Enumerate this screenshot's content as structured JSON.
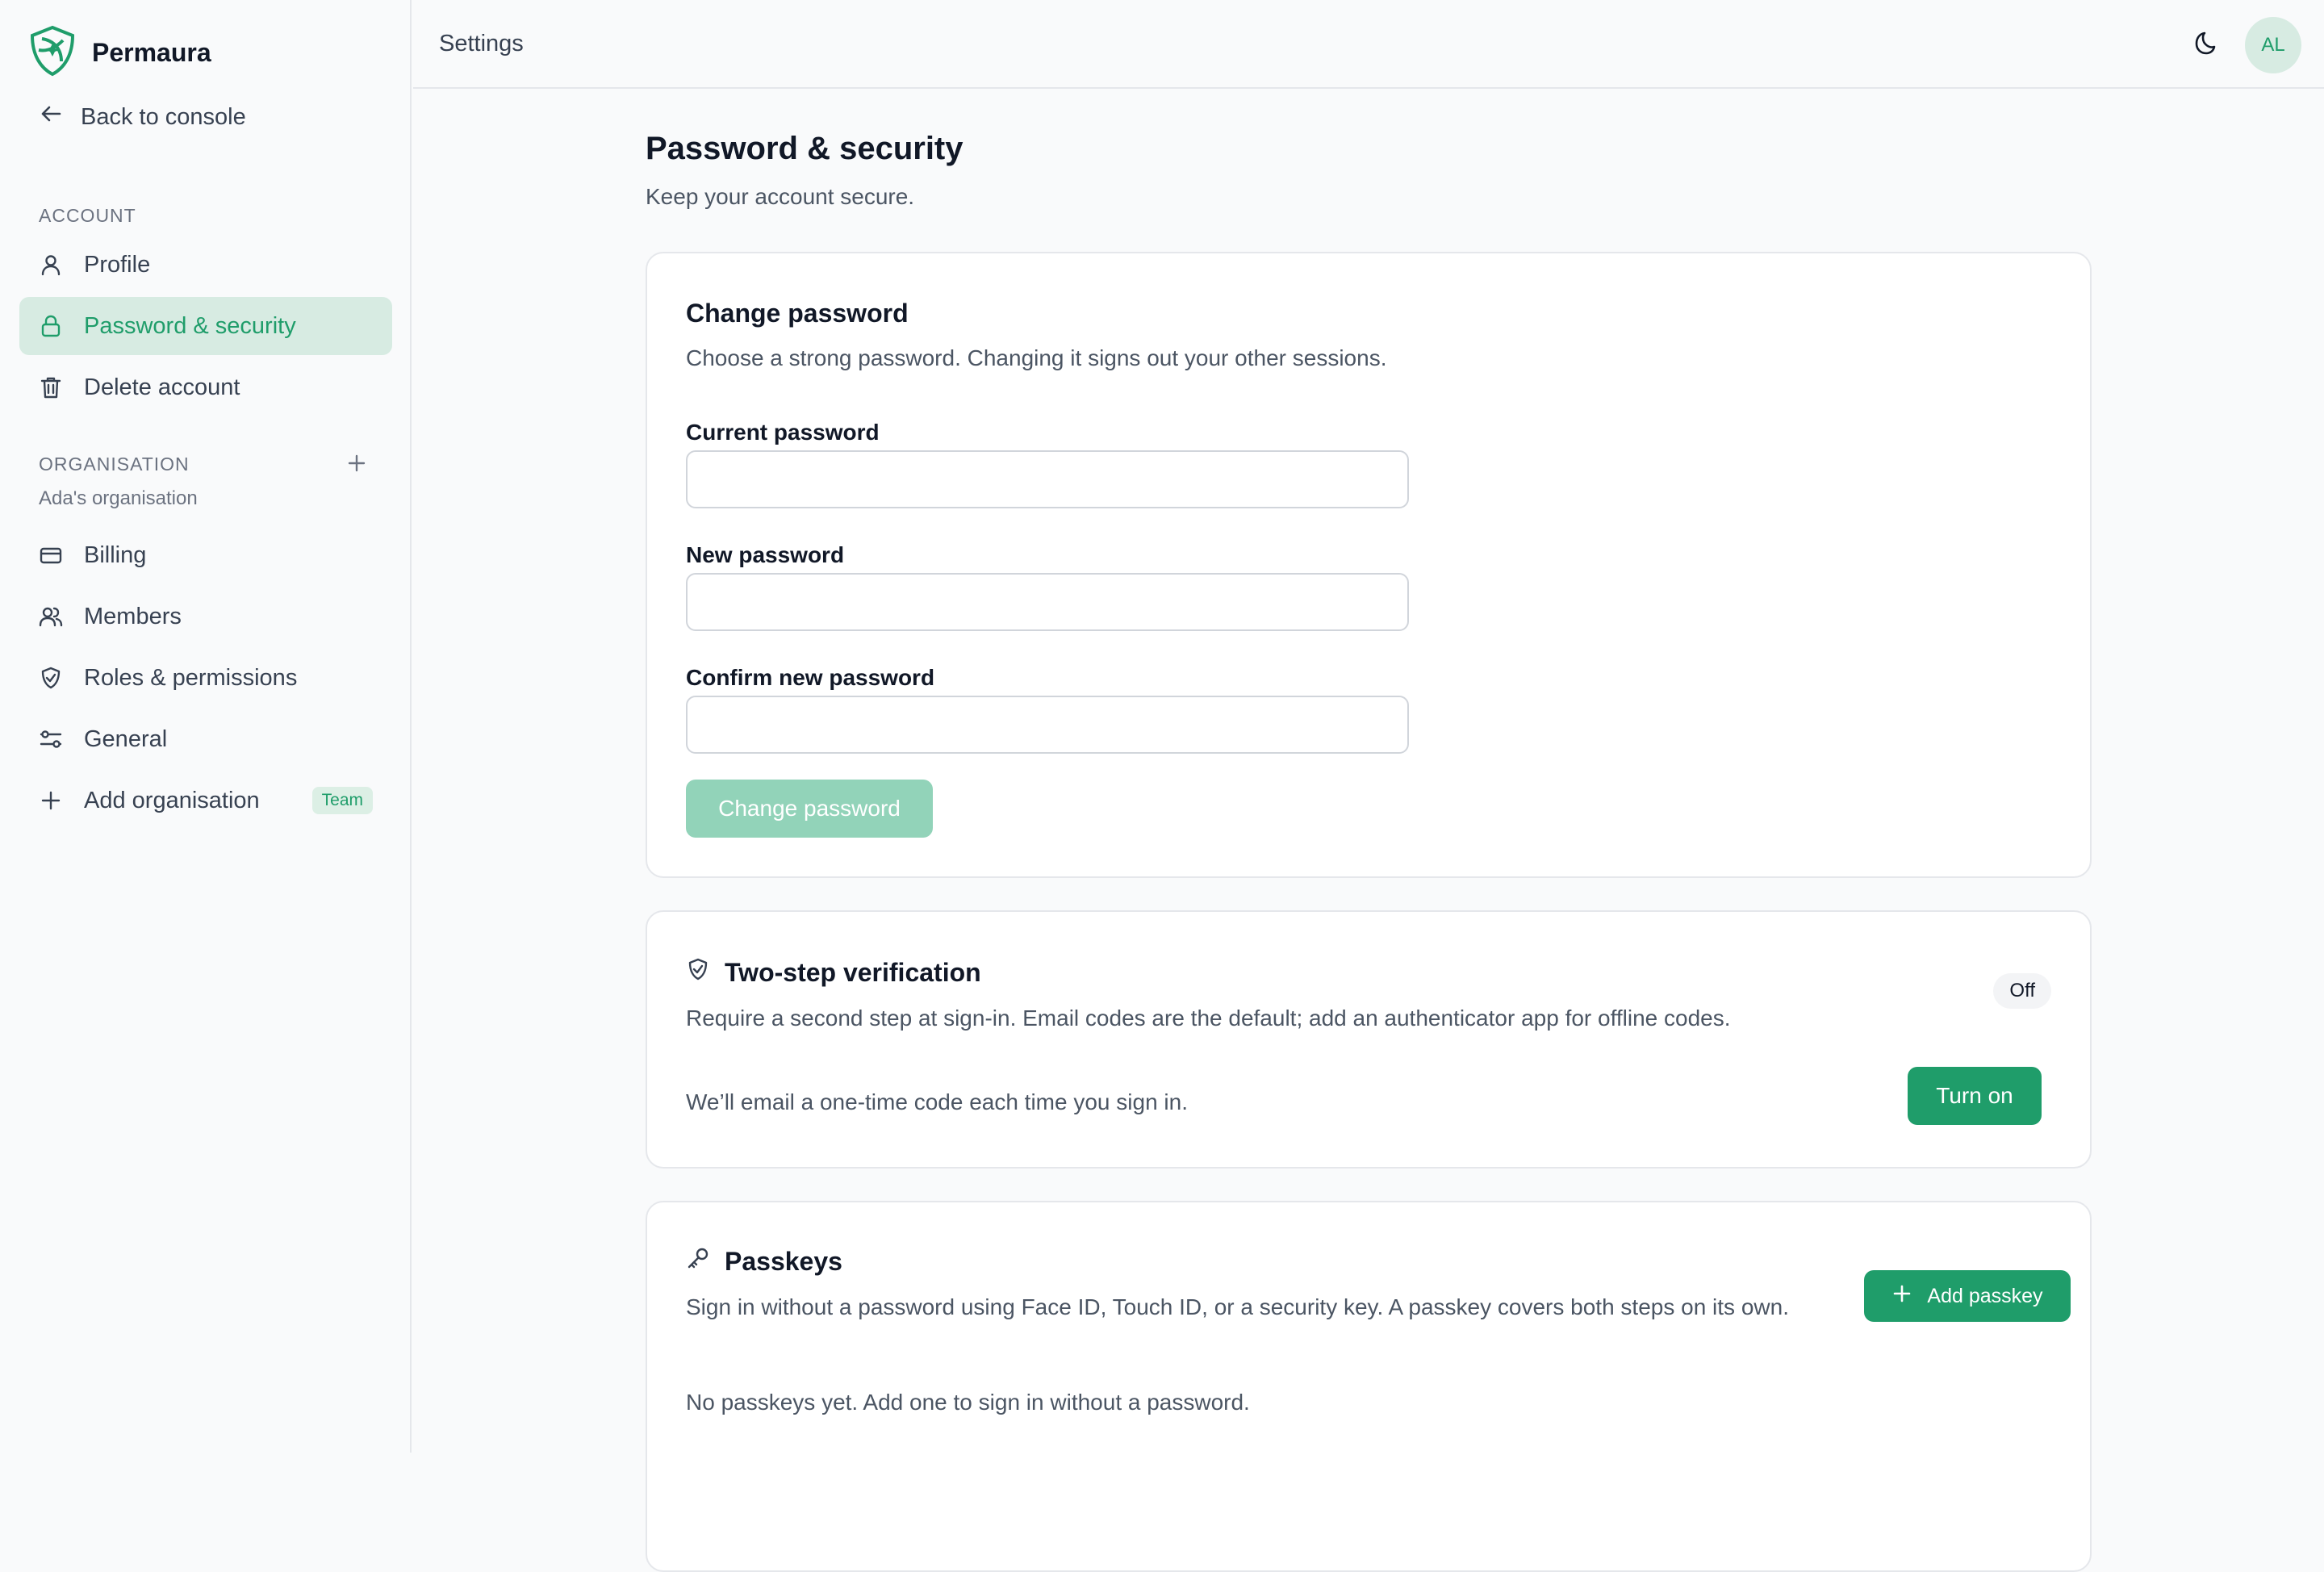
{
  "app": {
    "name": "Permaura"
  },
  "sidebar": {
    "back_label": "Back to console",
    "account_heading": "ACCOUNT",
    "account_items": [
      {
        "label": "Profile",
        "icon": "user-icon"
      },
      {
        "label": "Password & security",
        "icon": "lock-icon",
        "active": true
      },
      {
        "label": "Delete account",
        "icon": "trash-icon"
      }
    ],
    "org_heading": "ORGANISATION",
    "org_name": "Ada's organisation",
    "org_items": [
      {
        "label": "Billing",
        "icon": "credit-card-icon"
      },
      {
        "label": "Members",
        "icon": "users-icon"
      },
      {
        "label": "Roles & permissions",
        "icon": "shield-check-icon"
      },
      {
        "label": "General",
        "icon": "sliders-icon"
      },
      {
        "label": "Add organisation",
        "icon": "plus-icon",
        "badge": "Team"
      }
    ]
  },
  "topbar": {
    "title": "Settings",
    "avatar_initials": "AL",
    "theme_icon": "moon-icon"
  },
  "page": {
    "title": "Password & security",
    "subtitle": "Keep your account secure."
  },
  "change_password": {
    "title": "Change password",
    "description": "Choose a strong password. Changing it signs out your other sessions.",
    "current_label": "Current password",
    "current_value": "",
    "new_label": "New password",
    "new_value": "",
    "confirm_label": "Confirm new password",
    "confirm_value": "",
    "button_label": "Change password"
  },
  "two_step": {
    "title": "Two-step verification",
    "status": "Off",
    "description": "Require a second step at sign-in. Email codes are the default; add an authenticator app for offline codes.",
    "info": "We’ll email a one-time code each time you sign in.",
    "button_label": "Turn on"
  },
  "passkeys": {
    "title": "Passkeys",
    "description": "Sign in without a password using Face ID, Touch ID, or a security key. A passkey covers both steps on its own.",
    "empty": "No passkeys yet. Add one to sign in without a password.",
    "button_label": "Add passkey"
  },
  "colors": {
    "accent": "#1f9d6a",
    "accent_light": "#d7ebe2",
    "disabled": "#92d3b9"
  }
}
